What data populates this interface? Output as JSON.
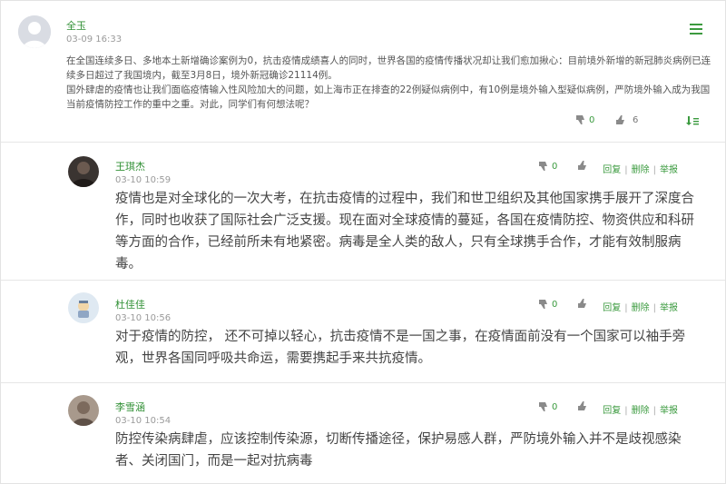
{
  "post": {
    "author": "全玉",
    "time": "03-09 16:33",
    "paragraph1": "在全国连续多日、多地本土新增确诊案例为0，抗击疫情成绩喜人的同时，世界各国的疫情传播状况却让我们愈加揪心：目前境外新增的新冠肺炎病例已连续多日超过了我国境内，截至3月8日，境外新冠确诊21114例。",
    "paragraph2": "国外肆虐的疫情也让我们面临疫情输入性风险加大的问题，如上海市正在排查的22例疑似病例中，有10例是境外输入型疑似病例，严防境外输入成为我国当前疫情防控工作的重中之重。对此，同学们有何想法呢？",
    "dislike_count": "0",
    "like_count": "6"
  },
  "replies": [
    {
      "author": "王琪杰",
      "time": "03-10 10:59",
      "content": "疫情也是对全球化的一次大考，在抗击疫情的过程中，我们和世卫组织及其他国家携手展开了深度合作，同时也收获了国际社会广泛支援。现在面对全球疫情的蔓延，各国在疫情防控、物资供应和科研等方面的合作，已经前所未有地紧密。病毒是全人类的敌人，只有全球携手合作，才能有效制服病毒。",
      "dislike_count": "0"
    },
    {
      "author": "杜佳佳",
      "time": "03-10 10:56",
      "content": "对于疫情的防控，  还不可掉以轻心，抗击疫情不是一国之事，在疫情面前没有一个国家可以袖手旁观，世界各国同呼吸共命运，需要携起手来共抗疫情。",
      "dislike_count": "0"
    },
    {
      "author": "李雪涵",
      "time": "03-10 10:54",
      "content": "防控传染病肆虐，应该控制传染源，切断传播途径，保护易感人群，严防境外输入并不是歧视感染者、关闭国门，而是一起对抗病毒",
      "dislike_count": "0"
    }
  ],
  "actions": {
    "reply": "回复",
    "delete": "删除",
    "report": "举报",
    "separator": "|"
  },
  "icons": {
    "menu": "menu-icon",
    "dislike": "thumbs-down-icon",
    "like": "thumbs-up-icon",
    "sort": "sort-down-icon"
  },
  "colors": {
    "accent": "#3a9a3e",
    "username": "#2f8f33",
    "muted": "#9a9a9a",
    "divider": "#e6e6e6"
  }
}
